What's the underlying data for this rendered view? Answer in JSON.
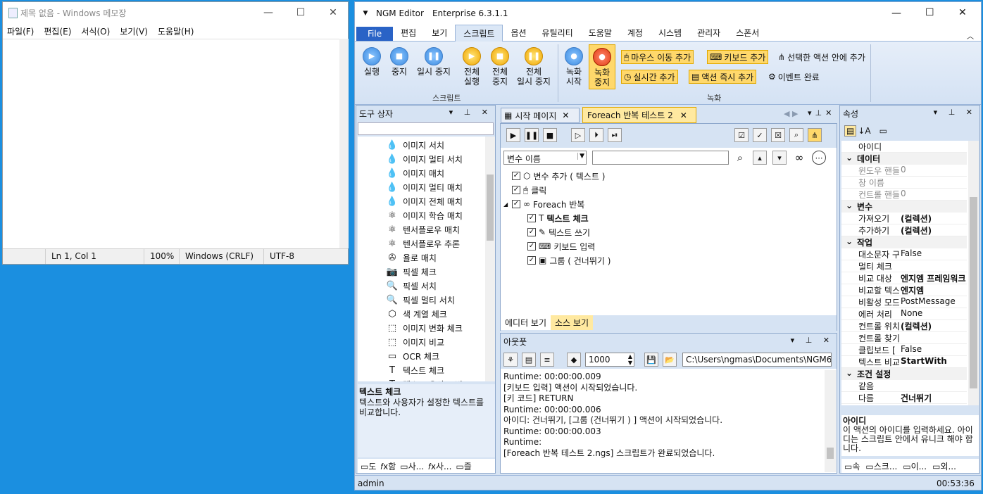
{
  "notepad": {
    "title": "제목 없음 - Windows 메모장",
    "menu": [
      "파일(F)",
      "편집(E)",
      "서식(O)",
      "보기(V)",
      "도움말(H)"
    ],
    "status": {
      "position": "Ln 1, Col 1",
      "zoom": "100%",
      "eol": "Windows (CRLF)",
      "encoding": "UTF-8"
    }
  },
  "ngm": {
    "title": "NGM Editor",
    "edition": "Enterprise 6.3.1.1",
    "tabs": [
      "File",
      "편집",
      "보기",
      "스크립트",
      "옵션",
      "유틸리티",
      "도움말",
      "계정",
      "시스템",
      "관리자",
      "스폰서"
    ],
    "active_tab": "스크립트",
    "ribbon": {
      "run": "실행",
      "stop": "중지",
      "pause": "일시 중지",
      "run_all_1": "전체",
      "run_all_2": "실행",
      "stop_all_1": "전체",
      "stop_all_2": "중지",
      "pause_all_1": "전체",
      "pause_all_2": "일시 중지",
      "script_group": "스크립트",
      "rec_start_1": "녹화",
      "rec_start_2": "시작",
      "rec_stop_1": "녹화",
      "rec_stop_2": "중지",
      "mouse_move": "마우스 이동 추가",
      "keyboard": "키보드 추가",
      "in_selected": "선택한 액션 안에 추가",
      "realtime": "실시간 추가",
      "action_now": "액션 즉시 추가",
      "event_done": "이벤트 완료",
      "record_group": "녹화"
    },
    "toolbox": {
      "title": "도구 상자",
      "items": [
        {
          "icon": "drops-icon",
          "label": "이미지 서치"
        },
        {
          "icon": "drops-filled-icon",
          "label": "이미지 멀티 서치"
        },
        {
          "icon": "drops-icon",
          "label": "이미지 매치"
        },
        {
          "icon": "drops-filled-icon",
          "label": "이미지 멀티 매치"
        },
        {
          "icon": "drops-icon",
          "label": "이미지 전체 매치"
        },
        {
          "icon": "atom-icon",
          "label": "이미지 학습 매치"
        },
        {
          "icon": "atom-icon",
          "label": "텐서플로우 매치"
        },
        {
          "icon": "atom-icon",
          "label": "텐서플로우 추론"
        },
        {
          "icon": "compass-icon",
          "label": "욜로 매치"
        },
        {
          "icon": "camera-icon",
          "label": "픽셀 체크"
        },
        {
          "icon": "magnifier-icon",
          "label": "픽셀 서치"
        },
        {
          "icon": "magnifier-icon",
          "label": "픽셀 멀티 서치"
        },
        {
          "icon": "cube-icon",
          "label": "색 계열 체크"
        },
        {
          "icon": "frame-icon",
          "label": "이미지 변화 체크"
        },
        {
          "icon": "frame-icon",
          "label": "이미지 비교"
        },
        {
          "icon": "ocr-icon",
          "label": "OCR 체크"
        },
        {
          "icon": "text-icon",
          "label": "텍스트 체크"
        },
        {
          "icon": "text-icon",
          "label": "텍스트 유사도 비교"
        }
      ],
      "desc_title": "텍스트 체크",
      "desc_body": "텍스트와 사용자가 설정한 텍스트를 비교합니다.",
      "bottom_tabs": [
        "도",
        "함",
        "사...",
        "사...",
        "즐"
      ]
    },
    "doc_tabs": [
      {
        "label": "시작 페이지",
        "active": false
      },
      {
        "label": "Foreach 반복 테스트 2",
        "active": true
      }
    ],
    "editor": {
      "var_select": "변수 이름",
      "tree": [
        {
          "indent": 0,
          "label": "변수 추가 ( 텍스트 )",
          "bold": false,
          "expander": ""
        },
        {
          "indent": 0,
          "label": "클릭",
          "bold": false,
          "expander": ""
        },
        {
          "indent": 0,
          "label": "Foreach 반복",
          "bold": false,
          "expander": "◢"
        },
        {
          "indent": 1,
          "label": "텍스트 체크",
          "bold": true,
          "expander": ""
        },
        {
          "indent": 1,
          "label": "텍스트 쓰기",
          "bold": false,
          "expander": ""
        },
        {
          "indent": 1,
          "label": "키보드 입력",
          "bold": false,
          "expander": ""
        },
        {
          "indent": 1,
          "label": "그룹 ( 건너뛰기 )",
          "bold": false,
          "expander": ""
        }
      ],
      "bottom_tabs": [
        "에디터 보기",
        "소스 보기"
      ]
    },
    "output": {
      "title": "아웃풋",
      "count": "1000",
      "path": "C:\\Users\\ngmas\\Documents\\NGM6\\",
      "lines": [
        "Runtime: 00:00:00.009",
        "[키보드 입력] 액션이 시작되었습니다.",
        "[키 코드] RETURN",
        "Runtime: 00:00:00.006",
        "아이디: 건너뛰기, [그룹 (건너뛰기 ) ] 액션이 시작되었습니다.",
        "Runtime: 00:00:00.003",
        "Runtime:",
        "[Foreach 반복 테스트 2.ngs] 스크립트가 완료되었습니다."
      ]
    },
    "props": {
      "title": "속성",
      "rows": [
        {
          "type": "prop",
          "k": "아이디",
          "v": "",
          "bold": false
        },
        {
          "type": "cat",
          "k": "데이터"
        },
        {
          "type": "prop",
          "k": "윈도우 핸들",
          "v": "0",
          "bold": false,
          "dim": true
        },
        {
          "type": "prop",
          "k": "창 이름",
          "v": "",
          "bold": false,
          "dim": true
        },
        {
          "type": "prop",
          "k": "컨트롤 핸들",
          "v": "0",
          "bold": false,
          "dim": true
        },
        {
          "type": "cat",
          "k": "변수"
        },
        {
          "type": "prop",
          "k": "가져오기",
          "v": "(컬렉션)",
          "bold": true
        },
        {
          "type": "prop",
          "k": "추가하기",
          "v": "(컬렉션)",
          "bold": true
        },
        {
          "type": "cat",
          "k": "작업"
        },
        {
          "type": "prop",
          "k": "대소문자 구분",
          "v": "False",
          "bold": false
        },
        {
          "type": "prop",
          "k": "멀티 체크",
          "v": "",
          "bold": false
        },
        {
          "type": "prop",
          "k": "비교 대상",
          "v": "엔지엠 프레임워크",
          "bold": true
        },
        {
          "type": "prop",
          "k": "비교할 텍스트",
          "v": "엔지엠",
          "bold": true
        },
        {
          "type": "prop",
          "k": "비활성 모드",
          "v": "PostMessage",
          "bold": false
        },
        {
          "type": "prop",
          "k": "에러 처리",
          "v": "None",
          "bold": false
        },
        {
          "type": "prop",
          "k": "컨트롤 위치",
          "v": "(컬렉션)",
          "bold": true
        },
        {
          "type": "prop",
          "k": "컨트롤 찾기",
          "v": "",
          "bold": false
        },
        {
          "type": "prop",
          "k": "클립보드 [",
          "v": "False",
          "bold": false
        },
        {
          "type": "prop",
          "k": "텍스트 비교",
          "v": "StartWith",
          "bold": true
        },
        {
          "type": "cat",
          "k": "조건 설정"
        },
        {
          "type": "prop",
          "k": "같음",
          "v": "",
          "bold": false
        },
        {
          "type": "prop",
          "k": "다름",
          "v": "건너뛰기",
          "bold": true
        }
      ],
      "desc_title": "아이디",
      "desc_body": "이 액션의 아이디를 입력하세요. 아이디는 스크립트 안에서 유니크 해야 합니다.",
      "bottom_tabs": [
        "속",
        "스크...",
        "이...",
        "외..."
      ]
    },
    "status": {
      "user": "admin",
      "time": "00:53:36"
    }
  }
}
